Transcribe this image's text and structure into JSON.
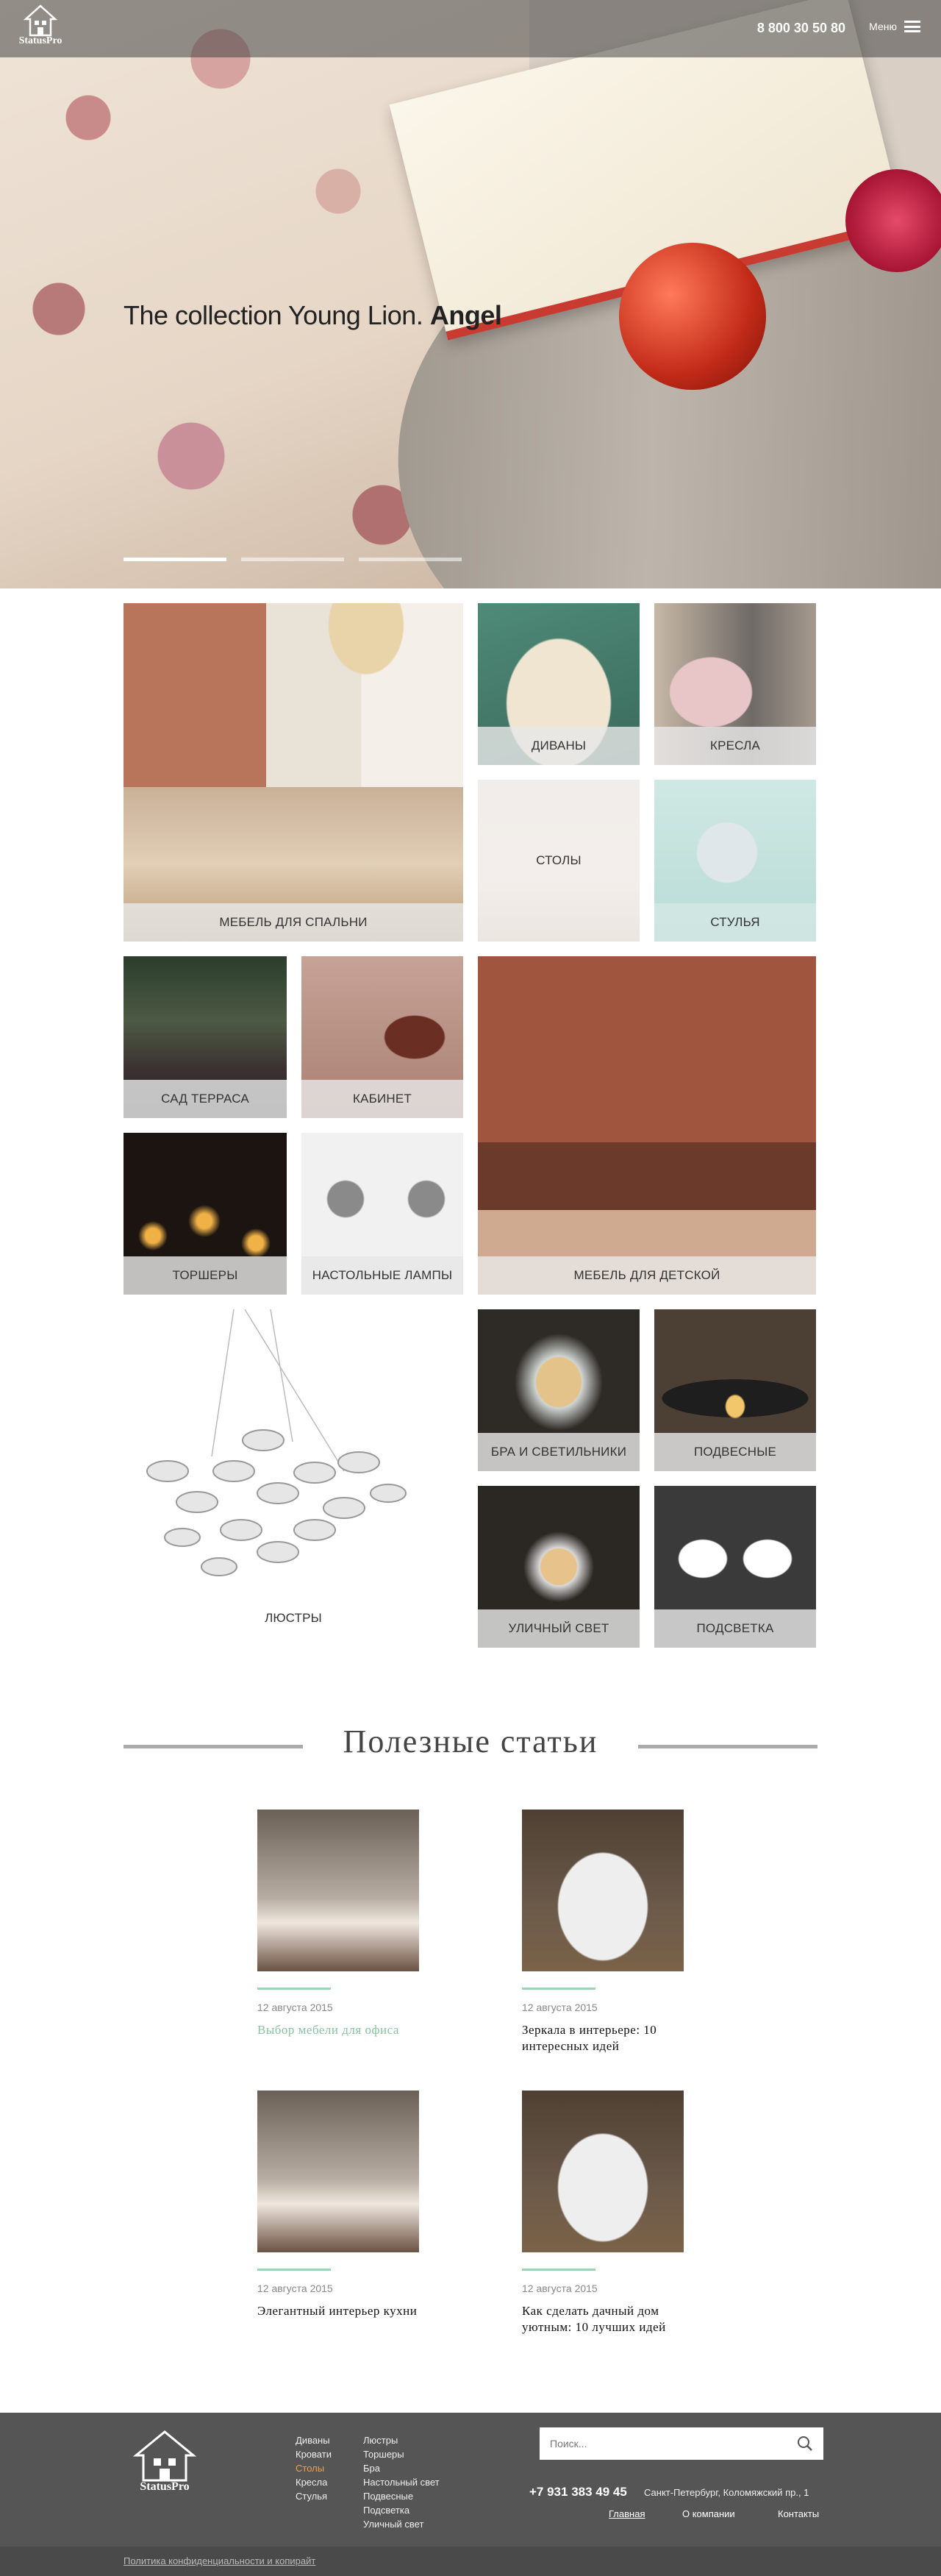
{
  "header": {
    "logo_text": "StatusPro",
    "phone": "8 800 30 50 80",
    "menu_label": "Меню"
  },
  "hero": {
    "title_light": "The collection Young Lion.",
    "title_bold": "Angel",
    "slides": 3,
    "active_slide": 1
  },
  "categories": [
    {
      "label": "МЕБЕЛЬ ДЛЯ СПАЛЬНИ"
    },
    {
      "label": "ДИВАНЫ"
    },
    {
      "label": "КРЕСЛА"
    },
    {
      "label": "СТОЛЫ"
    },
    {
      "label": "СТУЛЬЯ"
    },
    {
      "label": "САД ТЕРРАСА"
    },
    {
      "label": "КАБИНЕТ"
    },
    {
      "label": "МЕБЕЛЬ ДЛЯ ДЕТСКОЙ"
    },
    {
      "label": "ТОРШЕРЫ"
    },
    {
      "label": "НАСТОЛЬНЫЕ ЛАМПЫ"
    },
    {
      "label": "ЛЮСТРЫ"
    },
    {
      "label": "БРА И СВЕТИЛЬНИКИ"
    },
    {
      "label": "ПОДВЕСНЫЕ"
    },
    {
      "label": "УЛИЧНЫЙ СВЕТ"
    },
    {
      "label": "ПОДСВЕТКА"
    }
  ],
  "articles_section": {
    "title": "Полезные статьи",
    "items": [
      {
        "date": "12 августа 2015",
        "title": "Выбор мебели для офиса"
      },
      {
        "date": "12 августа 2015",
        "title": "Зеркала в интерьере: 10 интересных идей"
      },
      {
        "date": "12 августа 2015",
        "title": "Элегантный интерьер кухни"
      },
      {
        "date": "12 августа 2015",
        "title": "Как сделать дачный дом уютным: 10 лучших идей"
      }
    ]
  },
  "footer": {
    "logo_text": "StatusPro",
    "links_col1": [
      "Диваны",
      "Кровати",
      "Столы",
      "Кресла",
      "Стулья"
    ],
    "links_col2": [
      "Люстры",
      "Торшеры",
      "Бра",
      "Настольный свет",
      "Подвесные",
      "Подсветка",
      "Уличный свет"
    ],
    "search_placeholder": "Поиск...",
    "phone": "+7 931 383 49 45",
    "address": "Санкт-Петербург, Коломяжский пр., 1",
    "nav": [
      "Главная",
      "О компании",
      "Контакты"
    ],
    "policy": "Политика конфиденциальности и копирайт",
    "accent_color": "#f0a04b"
  }
}
